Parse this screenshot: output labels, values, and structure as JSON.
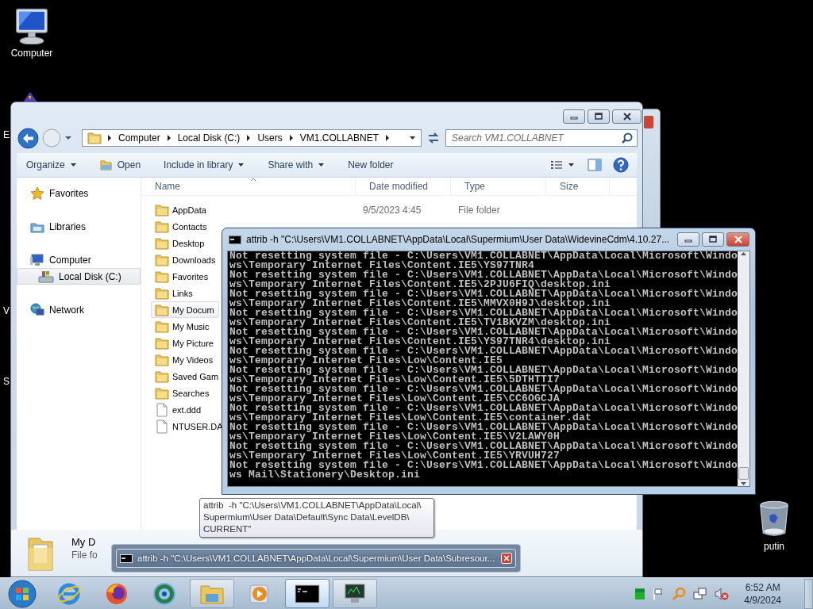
{
  "desktop": {
    "icons": [
      {
        "label": "Computer",
        "kind": "computer"
      },
      {
        "label": "putin",
        "kind": "recycle-bin"
      }
    ],
    "cut_labels": [
      "E",
      "V",
      "S"
    ]
  },
  "explorer": {
    "breadcrumb": [
      "Computer",
      "Local Disk (C:)",
      "Users",
      "VM1.COLLABNET"
    ],
    "search": {
      "placeholder": "Search VM1.COLLABNET"
    },
    "toolbar": [
      {
        "label": "Organize",
        "kind": "menu"
      },
      {
        "label": "Open",
        "kind": "open"
      },
      {
        "label": "Include in library",
        "kind": "menu"
      },
      {
        "label": "Share with",
        "kind": "menu"
      },
      {
        "label": "New folder",
        "kind": "plain"
      }
    ],
    "nav": [
      {
        "label": "Favorites",
        "kind": "favorites",
        "selected": false
      },
      {
        "label": "Libraries",
        "kind": "libraries",
        "selected": false
      },
      {
        "label": "Computer",
        "kind": "computer",
        "selected": false,
        "children": [
          {
            "label": "Local Disk (C:)",
            "kind": "drive",
            "selected": true
          }
        ]
      },
      {
        "label": "Network",
        "kind": "network",
        "selected": false
      }
    ],
    "columns": [
      "Name",
      "Date modified",
      "Type",
      "Size"
    ],
    "files": [
      {
        "name": "AppData",
        "date_modified": "9/5/2023 4:45",
        "type": "File folder",
        "kind": "folder",
        "selected": false
      },
      {
        "name": "Contacts",
        "kind": "folder",
        "selected": false
      },
      {
        "name": "Desktop",
        "kind": "folder",
        "selected": false
      },
      {
        "name": "Downloads",
        "kind": "folder",
        "selected": false
      },
      {
        "name": "Favorites",
        "kind": "folder",
        "selected": false
      },
      {
        "name": "Links",
        "kind": "folder",
        "selected": false
      },
      {
        "name": "My Docum",
        "kind": "folder",
        "selected": true
      },
      {
        "name": "My Music",
        "kind": "folder",
        "selected": false
      },
      {
        "name": "My Picture",
        "kind": "folder",
        "selected": false
      },
      {
        "name": "My Videos",
        "kind": "folder",
        "selected": false
      },
      {
        "name": "Saved Gam",
        "kind": "folder",
        "selected": false
      },
      {
        "name": "Searches",
        "kind": "folder",
        "selected": false
      },
      {
        "name": "ext.ddd",
        "kind": "file",
        "selected": false
      },
      {
        "name": "NTUSER.DA",
        "kind": "file",
        "selected": false
      }
    ],
    "details": {
      "name": "My D",
      "type": "File fo"
    }
  },
  "console": {
    "title": "attrib  -h \"C:\\Users\\VM1.COLLABNET\\AppData\\Local\\Supermium\\User Data\\WidevineCdm\\4.10.27...",
    "lines": [
      "Not resetting system file - C:\\Users\\VM1.COLLABNET\\AppData\\Local\\Microsoft\\Windo",
      "ws\\Temporary Internet Files\\Content.IE5\\YS97TNR4",
      "Not resetting system file - C:\\Users\\VM1.COLLABNET\\AppData\\Local\\Microsoft\\Windo",
      "ws\\Temporary Internet Files\\Content.IE5\\2PJU6FIQ\\desktop.ini",
      "Not resetting system file - C:\\Users\\VM1.COLLABNET\\AppData\\Local\\Microsoft\\Windo",
      "ws\\Temporary Internet Files\\Content.IE5\\MMVX0H9J\\desktop.ini",
      "Not resetting system file - C:\\Users\\VM1.COLLABNET\\AppData\\Local\\Microsoft\\Windo",
      "ws\\Temporary Internet Files\\Content.IE5\\TV1BKVZM\\desktop.ini",
      "Not resetting system file - C:\\Users\\VM1.COLLABNET\\AppData\\Local\\Microsoft\\Windo",
      "ws\\Temporary Internet Files\\Content.IE5\\YS97TNR4\\desktop.ini",
      "Not resetting system file - C:\\Users\\VM1.COLLABNET\\AppData\\Local\\Microsoft\\Windo",
      "ws\\Temporary Internet Files\\Low\\Content.IE5",
      "Not resetting system file - C:\\Users\\VM1.COLLABNET\\AppData\\Local\\Microsoft\\Windo",
      "ws\\Temporary Internet Files\\Low\\Content.IE5\\5DTHTTI7",
      "Not resetting system file - C:\\Users\\VM1.COLLABNET\\AppData\\Local\\Microsoft\\Windo",
      "ws\\Temporary Internet Files\\Low\\Content.IE5\\CC6OGCJA",
      "Not resetting system file - C:\\Users\\VM1.COLLABNET\\AppData\\Local\\Microsoft\\Windo",
      "ws\\Temporary Internet Files\\Low\\Content.IE5\\container.dat",
      "Not resetting system file - C:\\Users\\VM1.COLLABNET\\AppData\\Local\\Microsoft\\Windo",
      "ws\\Temporary Internet Files\\Low\\Content.IE5\\V2LAWY0H",
      "Not resetting system file - C:\\Users\\VM1.COLLABNET\\AppData\\Local\\Microsoft\\Windo",
      "ws\\Temporary Internet Files\\Low\\Content.IE5\\YRVUH727",
      "Not resetting system file - C:\\Users\\VM1.COLLABNET\\AppData\\Local\\Microsoft\\Windo",
      "ws Mail\\Stationery\\Desktop.ini"
    ]
  },
  "tooltip": {
    "text": "attrib  -h \"C:\\Users\\VM1.COLLABNET\\AppData\\Local\\\nSupermium\\User Data\\Default\\Sync Data\\LevelDB\\\nCURRENT\""
  },
  "taskbar_preview": {
    "title": "attrib  -h \"C:\\Users\\VM1.COLLABNET\\AppData\\Local\\Supermium\\User Data\\Subresour..."
  },
  "taskbar": {
    "buttons": [
      {
        "kind": "internet-explorer",
        "open": false,
        "selected": false
      },
      {
        "kind": "firefox",
        "open": false,
        "selected": false
      },
      {
        "kind": "globe",
        "open": false,
        "selected": false
      },
      {
        "kind": "file-explorer",
        "open": true,
        "selected": false
      },
      {
        "kind": "media-player",
        "open": false,
        "selected": false
      },
      {
        "kind": "command-prompt",
        "open": true,
        "selected": true
      },
      {
        "kind": "monitor",
        "open": true,
        "selected": false
      }
    ],
    "clock": {
      "time": "6:52 AM",
      "date": "4/9/2024"
    }
  }
}
